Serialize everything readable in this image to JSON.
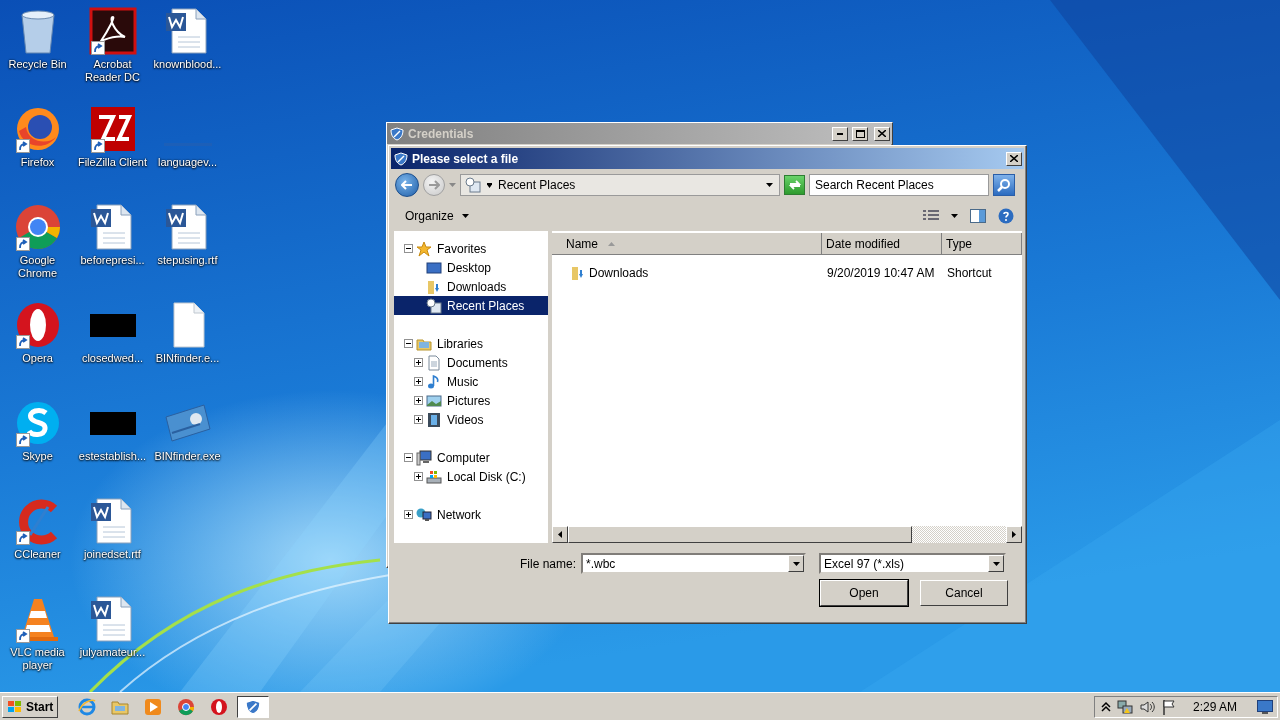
{
  "desktop_icons": [
    {
      "label": "Recycle Bin",
      "kind": "recycle",
      "shortcut": false
    },
    {
      "label": "Firefox",
      "kind": "firefox",
      "shortcut": true
    },
    {
      "label": "Google Chrome",
      "kind": "chrome",
      "shortcut": true
    },
    {
      "label": "Opera",
      "kind": "opera",
      "shortcut": true
    },
    {
      "label": "Skype",
      "kind": "skype",
      "shortcut": true
    },
    {
      "label": "CCleaner",
      "kind": "ccleaner",
      "shortcut": true
    },
    {
      "label": "VLC media player",
      "kind": "vlc",
      "shortcut": true
    },
    {
      "label": "Acrobat Reader DC",
      "kind": "acrobat",
      "shortcut": true
    },
    {
      "label": "FileZilla Client",
      "kind": "filezilla",
      "shortcut": true
    },
    {
      "label": "beforepresi...",
      "kind": "word",
      "shortcut": false
    },
    {
      "label": "closedwed...",
      "kind": "black",
      "shortcut": false
    },
    {
      "label": "estestablish...",
      "kind": "black",
      "shortcut": false
    },
    {
      "label": "joinedset.rtf",
      "kind": "word",
      "shortcut": false
    },
    {
      "label": "julyamateur...",
      "kind": "word",
      "shortcut": false
    },
    {
      "label": "knownblood...",
      "kind": "word",
      "shortcut": false
    },
    {
      "label": "languagev...",
      "kind": "blank",
      "shortcut": false
    },
    {
      "label": "stepusing.rtf",
      "kind": "word",
      "shortcut": false
    },
    {
      "label": "BINfinder.e...",
      "kind": "file",
      "shortcut": false
    },
    {
      "label": "BINfinder.exe",
      "kind": "card",
      "shortcut": false
    }
  ],
  "background_window": {
    "title": "Credentials"
  },
  "dialog": {
    "title": "Please select a file",
    "back": {
      "disabled": false
    },
    "forward": {
      "disabled": true
    },
    "address": "Recent Places",
    "search": {
      "placeholder": "Search Recent Places"
    },
    "organize": "Organize",
    "tree": [
      {
        "label": "Favorites",
        "kind": "star",
        "expanded": true,
        "selected": false,
        "children": [
          {
            "label": "Desktop",
            "kind": "desktop",
            "selected": false
          },
          {
            "label": "Downloads",
            "kind": "download",
            "selected": false
          },
          {
            "label": "Recent Places",
            "kind": "recent",
            "selected": true
          }
        ]
      },
      {
        "label": "Libraries",
        "kind": "library",
        "expanded": true,
        "selected": false,
        "children": [
          {
            "label": "Documents",
            "kind": "document",
            "expanded": false,
            "selected": false
          },
          {
            "label": "Music",
            "kind": "music",
            "expanded": false,
            "selected": false
          },
          {
            "label": "Pictures",
            "kind": "pictures",
            "expanded": false,
            "selected": false
          },
          {
            "label": "Videos",
            "kind": "videos",
            "expanded": false,
            "selected": false
          }
        ]
      },
      {
        "label": "Computer",
        "kind": "computer",
        "expanded": true,
        "selected": false,
        "children": [
          {
            "label": "Local Disk (C:)",
            "kind": "disk",
            "expanded": false,
            "selected": false
          }
        ]
      },
      {
        "label": "Network",
        "kind": "network",
        "expanded": false,
        "selected": false
      }
    ],
    "columns": [
      {
        "label": "Name",
        "sorted": true
      },
      {
        "label": "Date modified",
        "sorted": false
      },
      {
        "label": "Type",
        "sorted": false
      }
    ],
    "files": [
      {
        "name": "Downloads",
        "date": "9/20/2019 10:47 AM",
        "type": "Shortcut",
        "selected": false
      }
    ],
    "file_name": {
      "label": "File name:",
      "value": "*.wbc"
    },
    "file_type": "Excel 97 (*.xls)",
    "buttons": [
      {
        "label": "Open",
        "default": true
      },
      {
        "label": "Cancel",
        "default": false
      }
    ]
  },
  "taskbar": {
    "start": "Start",
    "apps": [
      {
        "kind": "ie",
        "active": false
      },
      {
        "kind": "explorer",
        "active": false
      },
      {
        "kind": "media",
        "active": false
      },
      {
        "kind": "chrome",
        "active": false
      },
      {
        "kind": "opera",
        "active": false
      },
      {
        "kind": "shield",
        "active": true
      }
    ],
    "clock": "2:29 AM"
  }
}
